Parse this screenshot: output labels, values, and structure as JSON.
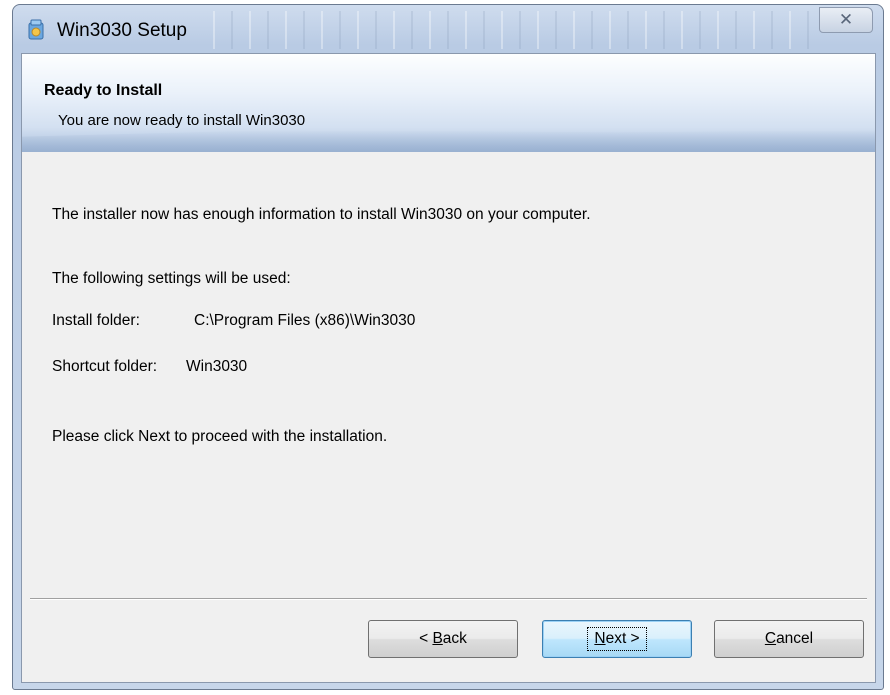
{
  "window": {
    "title": "Win3030 Setup",
    "close_glyph": "✕"
  },
  "banner": {
    "title": "Ready to Install",
    "subtitle": "You are now ready to install Win3030"
  },
  "content": {
    "intro": "The installer now has enough information to install Win3030 on your computer.",
    "settings_heading": "The following settings will be used:",
    "install_folder_label": "Install folder:",
    "install_folder_value": "C:\\Program Files (x86)\\Win3030",
    "shortcut_folder_label": "Shortcut folder:",
    "shortcut_folder_value": "Win3030",
    "proceed": "Please click Next to proceed with the installation."
  },
  "buttons": {
    "back": {
      "prefix": "< ",
      "mnemonic": "B",
      "rest": "ack"
    },
    "next": {
      "mnemonic": "N",
      "rest": "ext >"
    },
    "cancel": {
      "mnemonic": "C",
      "rest": "ancel"
    }
  },
  "icons": {
    "app": "installer-icon",
    "close": "close-icon"
  }
}
